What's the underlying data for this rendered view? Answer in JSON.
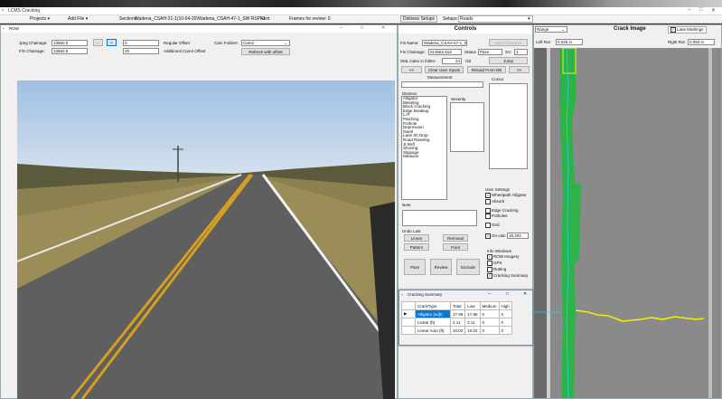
{
  "app": {
    "title": "LCMS Cracking",
    "menu": [
      "Projects ▾",
      "Add File ▾"
    ],
    "sections_label": "Sections:",
    "sections_value": "Wadena_CSAH-21-1(10-04-20\\Wadena_CSAH-47-1_SW RSP+1",
    "next_label": "Next",
    "frames_review": "Frames for review: 0",
    "distress_setups": "Distress Setups",
    "setups_label": "Setups:",
    "setups_value": "Roads"
  },
  "row": {
    "title": "ROW",
    "jpeg_chainage_label": "Jpeg Chainage:",
    "jpeg_chainage_value": "13560.0",
    "fs_chainage_label": "F/S Chainage:",
    "fs_chainage_value": "13562.5",
    "minus": "-",
    "plus": "+",
    "regular_offset_value": "0",
    "regular_offset_label": "Regular Offset",
    "additional_offset_value": "20",
    "additional_offset_label": "Additional Cam4 Offset",
    "cam_folders_label": "Cam Folders:",
    "cam_folders_value": "Cam2",
    "refresh_label": "Refresh with offset"
  },
  "controls": {
    "title": "Controls",
    "fis_name_label": "Fis Name:",
    "fis_name_value": "Wadena_CSAH-47-1_S",
    "save_changes": "Save Changes",
    "fis_chainage_label": "Fis Chainage:",
    "fis_chainage_value": "013562.512",
    "status_label": "Status",
    "status_value": "Pass",
    "sv_label": "SV:",
    "sv_value": "1",
    "xml_index_label": "XML index in folder:",
    "xml_index_value": "24",
    "xml_total": "/32",
    "jump": "Jump",
    "prev": "<<",
    "clear_inputs": "Clear User Inputs",
    "reload_db": "Reload From DB",
    "next": ">>",
    "measurement_label": "Measurement",
    "cursor_label": "Cursor",
    "distress_header": "Distress",
    "distress_items": [
      "Alligator",
      "Bleeding",
      "Block Cracking",
      "Edge Breakup",
      "LJT",
      "Patching",
      "Pothole",
      "Depression",
      "Swell",
      "Lane Sh Drop",
      "Road Raveling",
      "Jt Refl",
      "Shoving",
      "Slippage",
      "Measure"
    ],
    "severity_label": "Severity",
    "user_settings_label": "User Settings",
    "wheelpath_alligator": "Wheelpath Alligator",
    "absorb": "Absorb",
    "edge_cracking": "Edge Cracking",
    "potholes": "Potholes",
    "grid": "Grid",
    "note_label": "Note",
    "undo_last": "Undo Last",
    "linear": "Linear",
    "removal": "Removal",
    "pattern": "Pattern",
    "point": "Point",
    "on_calc_label": "On calc:",
    "on_calc_value": "16.404",
    "info_windows_label": "Info Windows",
    "row_imagery": "ROW Imagery",
    "gps": "GPS",
    "rutting": "Rutting",
    "cracking_summary": "Cracking Summary",
    "pass": "Pass",
    "review": "Review",
    "exclude": "Exclude"
  },
  "crack": {
    "range_value": "Range",
    "title": "Crack Image",
    "lane_markings": "Lane Markings",
    "left_rut_label": "Left Rut",
    "left_rut_value": "0.025 in",
    "right_rut_label": "Right Rut",
    "right_rut_value": "0.053 in"
  },
  "summary": {
    "title": "Cracking Summary",
    "headers": [
      "CrackType",
      "Total",
      "Low",
      "Medium",
      "High"
    ],
    "rows": [
      [
        "Alligator (sqft)",
        "17.98",
        "17.98",
        "0",
        "0"
      ],
      [
        "Linear (ft)",
        "2.11",
        "2.11",
        "0",
        "0"
      ],
      [
        "Linear Auto (ft)",
        "10.02",
        "10.02",
        "0",
        "0"
      ]
    ]
  },
  "colors": {
    "crack_green": "#2eb24a",
    "crack_yellow": "#f2f200",
    "crack_cyan": "#2ad4d4",
    "selected_row": "#0078d7"
  }
}
